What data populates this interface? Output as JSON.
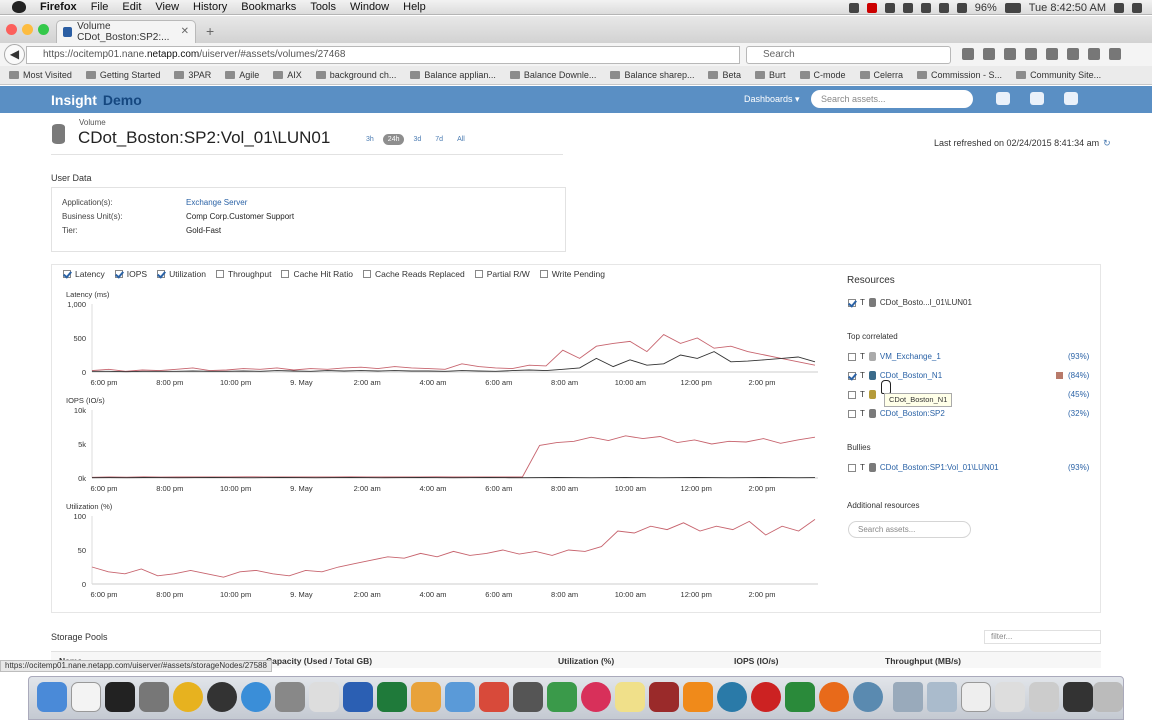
{
  "menubar": {
    "app": "Firefox",
    "items": [
      "File",
      "Edit",
      "View",
      "History",
      "Bookmarks",
      "Tools",
      "Window",
      "Help"
    ],
    "battery": "96%",
    "clock": "Tue 8:42:50 AM"
  },
  "browser": {
    "tab_title": "Volume CDot_Boston:SP2:...",
    "url_prefix": "https://ocitemp01.nane.",
    "url_domain": "netapp.com",
    "url_path": "/uiserver/#assets/volumes/27468",
    "search_placeholder": "Search",
    "bookmarks": [
      "Most Visited",
      "Getting Started",
      "3PAR",
      "Agile",
      "AIX",
      "background ch...",
      "Balance applian...",
      "Balance Downle...",
      "Balance sharep...",
      "Beta",
      "Burt",
      "C-mode",
      "Celerra",
      "Commission - S...",
      "Community Site..."
    ]
  },
  "app": {
    "brand": "Insight",
    "brand2": "Demo",
    "dashboards": "Dashboards",
    "search_placeholder": "Search assets..."
  },
  "volume": {
    "label": "Volume",
    "title": "CDot_Boston:SP2:Vol_01\\LUN01",
    "ranges": [
      "3h",
      "24h",
      "3d",
      "7d",
      "All"
    ],
    "selected_range": "24h",
    "refreshed": "Last refreshed on 02/24/2015 8:41:34 am"
  },
  "user_data": {
    "title": "User Data",
    "rows": [
      {
        "k": "Application(s):",
        "v": "Exchange Server"
      },
      {
        "k": "Business Unit(s):",
        "v": "Comp Corp.Customer Support"
      },
      {
        "k": "Tier:",
        "v": "Gold-Fast"
      }
    ]
  },
  "metrics": [
    {
      "label": "Latency",
      "checked": true
    },
    {
      "label": "IOPS",
      "checked": true
    },
    {
      "label": "Utilization",
      "checked": true
    },
    {
      "label": "Throughput",
      "checked": false
    },
    {
      "label": "Cache Hit Ratio",
      "checked": false
    },
    {
      "label": "Cache Reads Replaced",
      "checked": false
    },
    {
      "label": "Partial R/W",
      "checked": false
    },
    {
      "label": "Write Pending",
      "checked": false
    }
  ],
  "chart_data": [
    {
      "type": "line",
      "title": "Latency (ms)",
      "x": [
        "6:00 pm",
        "8:00 pm",
        "10:00 pm",
        "9. May",
        "2:00 am",
        "4:00 am",
        "6:00 am",
        "8:00 am",
        "10:00 am",
        "12:00 pm",
        "2:00 pm"
      ],
      "yticks": [
        "1,000",
        "500",
        "0"
      ],
      "ylim": [
        0,
        1000
      ],
      "series": [
        {
          "color": "#c7646e",
          "values": [
            20,
            40,
            10,
            30,
            20,
            40,
            60,
            20,
            30,
            50,
            40,
            60,
            30,
            50,
            40,
            60,
            70,
            50,
            80,
            60,
            50,
            40,
            120,
            80,
            60,
            50,
            100,
            90,
            320,
            200,
            380,
            420,
            450,
            300,
            550,
            420,
            500,
            350,
            380,
            300,
            250,
            200,
            150,
            100
          ]
        },
        {
          "color": "#333333",
          "values": [
            10,
            10,
            5,
            10,
            10,
            10,
            15,
            10,
            10,
            15,
            10,
            20,
            15,
            10,
            20,
            15,
            20,
            15,
            20,
            15,
            15,
            10,
            20,
            15,
            10,
            20,
            30,
            20,
            40,
            60,
            200,
            80,
            180,
            100,
            120,
            250,
            200,
            300,
            150,
            160,
            180,
            200,
            220,
            150
          ]
        }
      ]
    },
    {
      "type": "line",
      "title": "IOPS (IO/s)",
      "x": [
        "6:00 pm",
        "8:00 pm",
        "10:00 pm",
        "9. May",
        "2:00 am",
        "4:00 am",
        "6:00 am",
        "8:00 am",
        "10:00 am",
        "12:00 pm",
        "2:00 pm"
      ],
      "yticks": [
        "10k",
        "5k",
        "0k"
      ],
      "ylim": [
        0,
        10000
      ],
      "series": [
        {
          "color": "#c7646e",
          "values": [
            100,
            150,
            120,
            180,
            130,
            150,
            140,
            160,
            150,
            170,
            160,
            150,
            140,
            160,
            150,
            170,
            160,
            150,
            140,
            160,
            170,
            150,
            160,
            150,
            140,
            150,
            4800,
            5200,
            5400,
            6000,
            5500,
            6200,
            5800,
            6100,
            5200,
            5600,
            5000,
            5400,
            5300,
            5800,
            5100,
            5600,
            6000
          ]
        },
        {
          "color": "#333333",
          "values": [
            50,
            60,
            50,
            70,
            60,
            50,
            60,
            70,
            60,
            50,
            60,
            70,
            60,
            50,
            60,
            70,
            60,
            50,
            60,
            70,
            60,
            50,
            60,
            70,
            60,
            50,
            60,
            70,
            60,
            50,
            60,
            70,
            60,
            50,
            60,
            70,
            60,
            50,
            60,
            70,
            60,
            50,
            60
          ]
        }
      ]
    },
    {
      "type": "line",
      "title": "Utilization (%)",
      "x": [
        "6:00 pm",
        "8:00 pm",
        "10:00 pm",
        "9. May",
        "2:00 am",
        "4:00 am",
        "6:00 am",
        "8:00 am",
        "10:00 am",
        "12:00 pm",
        "2:00 pm"
      ],
      "yticks": [
        "100",
        "50",
        "0"
      ],
      "ylim": [
        0,
        100
      ],
      "series": [
        {
          "color": "#c7646e",
          "values": [
            25,
            18,
            15,
            22,
            12,
            15,
            20,
            15,
            10,
            18,
            20,
            15,
            12,
            20,
            18,
            25,
            30,
            35,
            40,
            38,
            45,
            40,
            48,
            42,
            45,
            50,
            44,
            48,
            42,
            50,
            48,
            55,
            78,
            75,
            85,
            80,
            90,
            78,
            85,
            80,
            92,
            72,
            85,
            78,
            95
          ]
        }
      ]
    }
  ],
  "resources": {
    "title": "Resources",
    "item": "CDot_Bosto...l_01\\LUN01",
    "top_title": "Top correlated",
    "top": [
      {
        "name": "VM_Exchange_1",
        "pct": "(93%)",
        "checked": false
      },
      {
        "name": "CDot_Boston_N1",
        "pct": "(84%)",
        "checked": true
      },
      {
        "name": "",
        "pct": "(45%)",
        "checked": false
      },
      {
        "name": "CDot_Boston:SP2",
        "pct": "(32%)",
        "checked": false
      }
    ],
    "tooltip": "CDot_Boston_N1",
    "bullies_title": "Bullies",
    "bullies": [
      {
        "name": "CDot_Boston:SP1:Vol_01\\LUN01",
        "pct": "(93%)"
      }
    ],
    "additional_title": "Additional resources",
    "additional_placeholder": "Search assets..."
  },
  "storage_pools": {
    "title": "Storage Pools",
    "filter_placeholder": "filter...",
    "columns": [
      "Name",
      "Capacity (Used / Total GB)",
      "Utilization (%)",
      "IOPS (IO/s)",
      "Throughput (MB/s)"
    ]
  },
  "status_url": "https://ocitemp01.nane.netapp.com/uiserver/#assets/storageNodes/27588"
}
